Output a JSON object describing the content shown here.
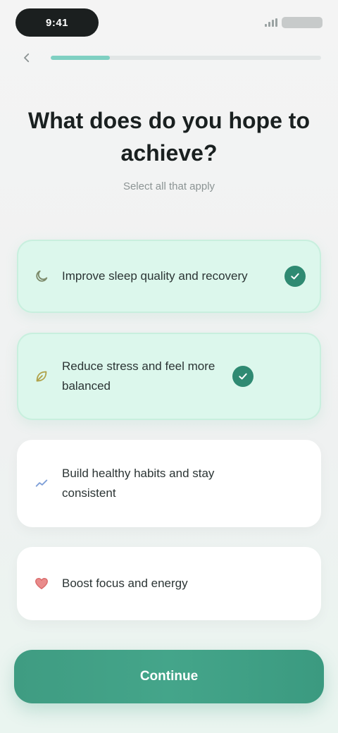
{
  "status_bar": {
    "time": "9:41",
    "battery_icon": "battery-icon",
    "signal_icon": "signal-icon"
  },
  "nav": {
    "back_icon": "back-arrow-icon",
    "progress": 0.22,
    "progress_color": "#7fd0c2"
  },
  "heading": {
    "title": "What does do you hope to achieve?",
    "subtitle": "Select all that apply"
  },
  "options": [
    {
      "label": "Improve sleep quality and recovery",
      "icon": "moon-icon",
      "selected": true
    },
    {
      "label": "Reduce stress and feel more balanced",
      "icon": "leaf-icon",
      "selected": true
    },
    {
      "label": "Build healthy habits and stay consistent",
      "icon": "chart-icon",
      "selected": false
    },
    {
      "label": "Boost focus and energy",
      "icon": "heart-icon",
      "selected": false
    }
  ],
  "colors": {
    "accent": "#3f9c82",
    "selected_bg": "#dcf7ec",
    "check": "#2f8a72"
  },
  "cta": {
    "label": "Continue"
  }
}
